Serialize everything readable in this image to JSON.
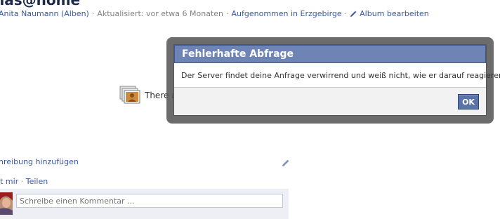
{
  "album": {
    "title": "nas@home",
    "owner": "Anita Naumann (Alben)",
    "updated": "Aktualisiert: vor etwa 6 Monaten",
    "location": "Aufgenommen in Erzgebirge",
    "edit_label": "Album bearbeiten"
  },
  "placeholder": {
    "text_visible": "There a"
  },
  "description": {
    "add_label": "chreibung hinzufügen"
  },
  "actions": {
    "like_label": "llt mir",
    "share_label": "Teilen"
  },
  "comment": {
    "placeholder": "Schreibe einen Kommentar ..."
  },
  "dialog": {
    "title": "Fehlerhafte Abfrage",
    "message": "Der Server findet deine Anfrage verwirrend und weiß nicht, wie er darauf reagieren soll.",
    "ok_label": "OK"
  },
  "colors": {
    "link": "#3b5998",
    "dialog_header": "#6d84b4",
    "button": "#5b74a8"
  },
  "icons": [
    "pencil-icon",
    "photo-stack-icon",
    "avatar"
  ]
}
